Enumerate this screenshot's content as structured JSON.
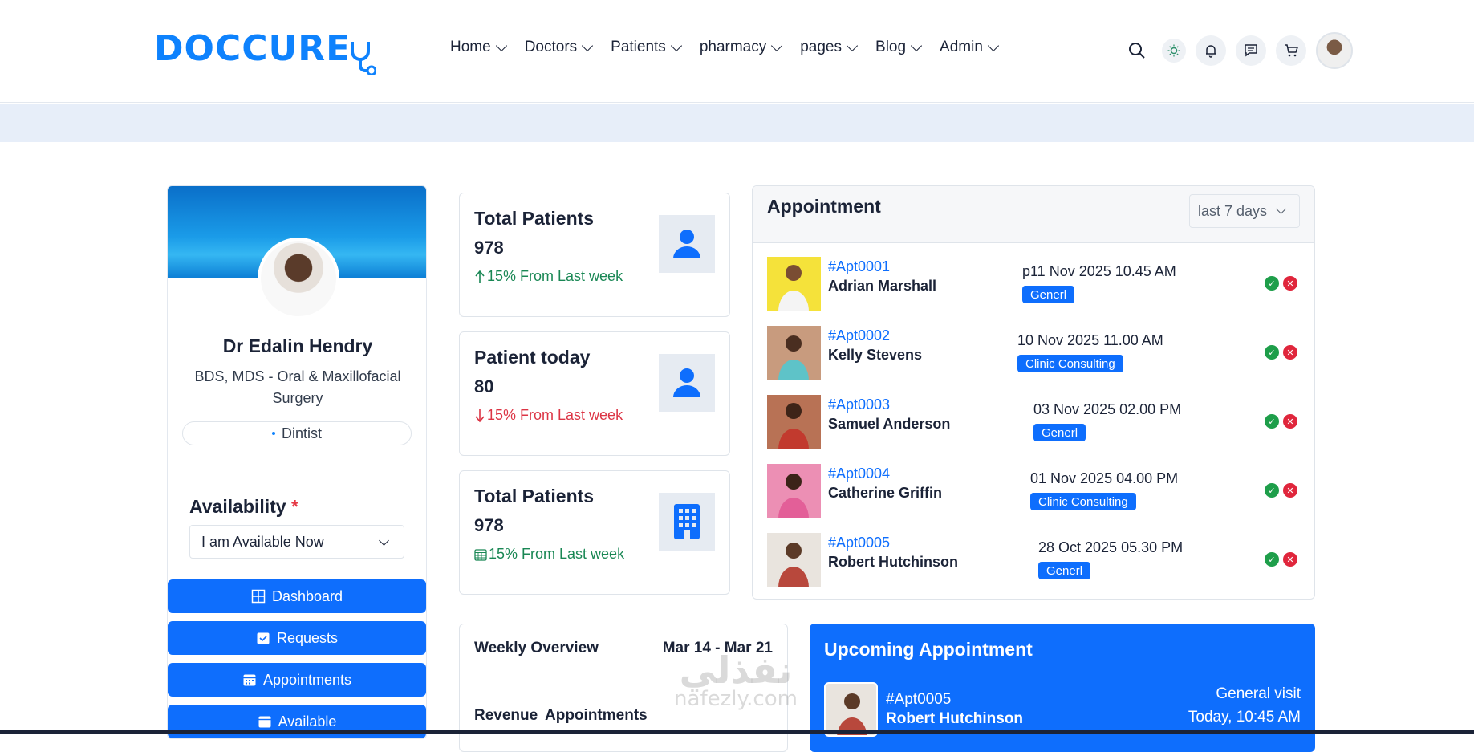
{
  "brand": {
    "logo_text": "DOCCURE",
    "accent": "#0e82fd"
  },
  "nav": {
    "items": [
      {
        "label": "Home"
      },
      {
        "label": "Doctors"
      },
      {
        "label": "Patients"
      },
      {
        "label": "pharmacy"
      },
      {
        "label": "pages"
      },
      {
        "label": "Blog"
      },
      {
        "label": "Admin"
      }
    ],
    "icons": [
      "search-icon",
      "theme-toggle-icon",
      "bell-icon",
      "chat-icon",
      "cart-icon"
    ]
  },
  "profile": {
    "name": "Dr Edalin Hendry",
    "qualification": "BDS, MDS - Oral & Maxillofacial Surgery",
    "speciality": "Dintist",
    "availability_label": "Availability",
    "availability_required": "*",
    "availability_value": "I am Available Now",
    "menu": [
      {
        "label": "Dashboard",
        "icon": "grid-icon"
      },
      {
        "label": "Requests",
        "icon": "calendar-check-icon"
      },
      {
        "label": "Appointments",
        "icon": "calendar-icon"
      },
      {
        "label": "Available",
        "icon": "calendar-icon"
      }
    ]
  },
  "stats": [
    {
      "title": "Total Patients",
      "value": "978",
      "change": "15% From Last week",
      "trend": "up",
      "icon": "user-icon"
    },
    {
      "title": "Patient today",
      "value": "80",
      "change": "15% From Last week",
      "trend": "down",
      "icon": "user-icon"
    },
    {
      "title": "Total Patients",
      "value": "978",
      "change": "15% From Last week",
      "trend": "calendar",
      "icon": "building-icon"
    }
  ],
  "appointments": {
    "title": "Appointment",
    "filter": "last 7 days",
    "rows": [
      {
        "id": "#Apt0001",
        "name": "Adrian Marshall",
        "date": "p11 Nov 2025 10.45 AM",
        "type": "Generl",
        "photo_bg": "#f5e23a"
      },
      {
        "id": "#Apt0002",
        "name": "Kelly Stevens",
        "date": "10 Nov 2025 11.00 AM",
        "type": "Clinic Consulting",
        "photo_bg": "#c89b7e"
      },
      {
        "id": "#Apt0003",
        "name": "Samuel Anderson",
        "date": "03 Nov 2025 02.00 PM",
        "type": "Generl",
        "photo_bg": "#b87255"
      },
      {
        "id": "#Apt0004",
        "name": "Catherine Griffin",
        "date": "01 Nov 2025 04.00 PM",
        "type": "Clinic Consulting",
        "photo_bg": "#ec8fb4"
      },
      {
        "id": "#Apt0005",
        "name": "Robert Hutchinson",
        "date": "28 Oct 2025 05.30 PM",
        "type": "Generl",
        "photo_bg": "#e9e4de"
      }
    ]
  },
  "weekly": {
    "title": "Weekly Overview",
    "range": "Mar 14 - Mar 21",
    "tabs": [
      "Revenue",
      "Appointments"
    ]
  },
  "upcoming": {
    "title": "Upcoming Appointment",
    "id": "#Apt0005",
    "name": "Robert Hutchinson",
    "type": "General visit",
    "time": "Today, 10:45 AM"
  },
  "watermark": {
    "arabic": "نفذلي",
    "latin": "nafezly.com"
  }
}
